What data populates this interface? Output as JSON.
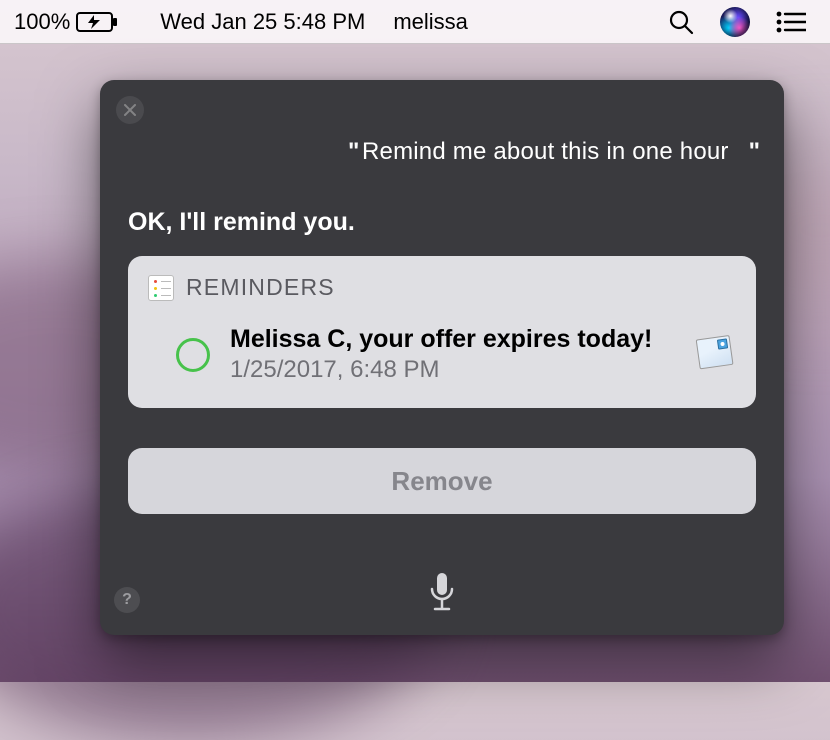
{
  "menubar": {
    "battery_percent": "100%",
    "datetime": "Wed Jan 25  5:48 PM",
    "username": "melissa",
    "icons": {
      "battery": "battery-charging-icon",
      "search": "search-icon",
      "siri": "siri-icon",
      "notifications": "notification-list-icon"
    }
  },
  "siri": {
    "user_query": "Remind me about this in one hour",
    "response": "OK, I'll remind you.",
    "card": {
      "app_name": "REMINDERS",
      "reminder_title": "Melissa C, your offer expires today!",
      "reminder_datetime": "1/25/2017, 6:48 PM",
      "source_icon": "mail-icon"
    },
    "remove_label": "Remove"
  }
}
